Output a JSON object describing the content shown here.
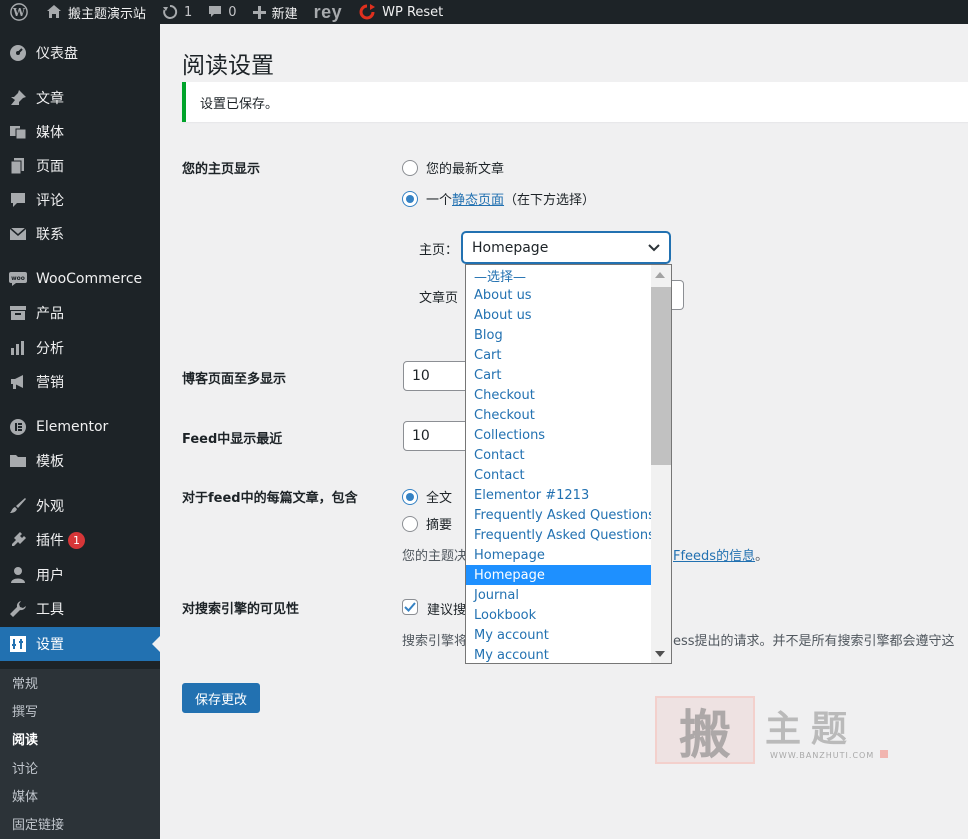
{
  "adminbar": {
    "site_name": "搬主题演示站",
    "updates_count": "1",
    "comments_count": "0",
    "new_label": "新建",
    "rey_label": "rey",
    "wp_reset_label": "WP Reset"
  },
  "sidebar": {
    "items": [
      {
        "label": "仪表盘",
        "icon": "dashboard-icon"
      },
      {
        "label": "文章",
        "icon": "pin-icon"
      },
      {
        "label": "媒体",
        "icon": "media-icon"
      },
      {
        "label": "页面",
        "icon": "page-icon"
      },
      {
        "label": "评论",
        "icon": "comment-icon"
      },
      {
        "label": "联系",
        "icon": "mail-icon"
      },
      {
        "label": "WooCommerce",
        "icon": "woo-icon"
      },
      {
        "label": "产品",
        "icon": "archive-icon"
      },
      {
        "label": "分析",
        "icon": "bar-chart-icon"
      },
      {
        "label": "营销",
        "icon": "megaphone-icon"
      },
      {
        "label": "Elementor",
        "icon": "elementor-icon"
      },
      {
        "label": "模板",
        "icon": "folder-icon"
      },
      {
        "label": "外观",
        "icon": "brush-icon"
      },
      {
        "label": "插件",
        "icon": "plugin-icon",
        "badge": "1"
      },
      {
        "label": "用户",
        "icon": "user-icon"
      },
      {
        "label": "工具",
        "icon": "wrench-icon"
      },
      {
        "label": "设置",
        "icon": "settings-icon"
      }
    ],
    "submenu": [
      "常规",
      "撰写",
      "阅读",
      "讨论",
      "媒体",
      "固定链接"
    ]
  },
  "page": {
    "title": "阅读设置",
    "notice": "设置已保存。",
    "homepage_label": "您的主页显示",
    "radio_latest": "您的最新文章",
    "radio_static_prefix": "一个",
    "radio_static_link": "静态页面",
    "radio_static_suffix": "（在下方选择）",
    "homepage_field_label": "主页：",
    "homepage_selected": "Homepage",
    "posts_page_label": "文章页",
    "blog_pages_label": "博客页面至多显示",
    "blog_pages_value": "10",
    "feed_label": "Feed中显示最近",
    "feed_value": "10",
    "feed_each_label": "对于feed中的每篇文章，包含",
    "radio_full": "全文",
    "radio_summary": "摘要",
    "feed_desc_start": "您的主题决",
    "feed_desc_link": "Ffeeds的信息",
    "feed_desc_end": "。",
    "seo_label": "对搜索引擎的可见性",
    "seo_checkbox": "建议搜",
    "seo_desc_start": "搜索引擎将",
    "seo_desc_end": "ess提出的请求。并不是所有搜索引擎都会遵守这",
    "save_button": "保存更改"
  },
  "dropdown": {
    "options": [
      "—选择—",
      "About us",
      "About us",
      "Blog",
      "Cart",
      "Cart",
      "Checkout",
      "Checkout",
      "Collections",
      "Contact",
      "Contact",
      "Elementor #1213",
      "Frequently Asked Questions",
      "Frequently Asked Questions",
      "Homepage",
      "Homepage",
      "Journal",
      "Lookbook",
      "My account",
      "My account"
    ],
    "selected_index": 15
  },
  "watermark": {
    "char": "搬",
    "text": "主题",
    "url": "WWW.BANZHUTI.COM"
  },
  "colors": {
    "accent": "#2271b1",
    "notice_success": "#00a32a",
    "admin_dark": "#1d2327",
    "badge": "#d63638"
  }
}
